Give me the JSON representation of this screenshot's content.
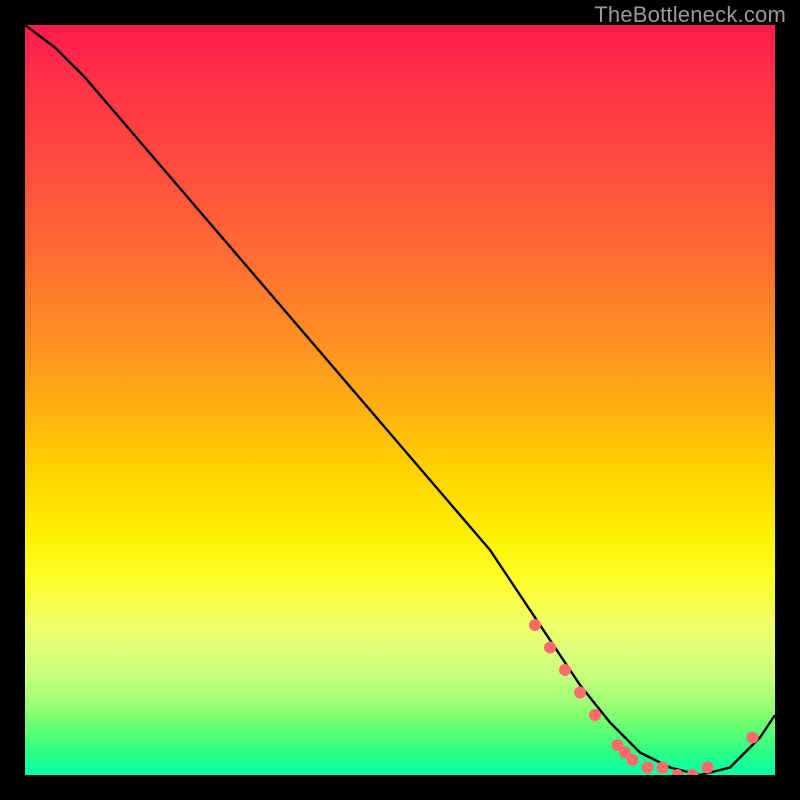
{
  "watermark": "TheBottleneck.com",
  "chart_data": {
    "type": "line",
    "title": "",
    "xlabel": "",
    "ylabel": "",
    "xlim": [
      0,
      100
    ],
    "ylim": [
      0,
      100
    ],
    "series": [
      {
        "name": "curve",
        "x": [
          0,
          4,
          8,
          14,
          20,
          26,
          32,
          38,
          44,
          50,
          56,
          62,
          66,
          70,
          74,
          78,
          82,
          86,
          90,
          94,
          98,
          100
        ],
        "y": [
          100,
          97,
          93,
          86,
          79,
          72,
          65,
          58,
          51,
          44,
          37,
          30,
          24,
          18,
          12,
          7,
          3,
          1,
          0,
          1,
          5,
          8
        ]
      }
    ],
    "markers": [
      {
        "x": 68,
        "y": 20
      },
      {
        "x": 70,
        "y": 17
      },
      {
        "x": 72,
        "y": 14
      },
      {
        "x": 74,
        "y": 11
      },
      {
        "x": 76,
        "y": 8
      },
      {
        "x": 79,
        "y": 4
      },
      {
        "x": 80,
        "y": 3
      },
      {
        "x": 81,
        "y": 2
      },
      {
        "x": 83,
        "y": 1
      },
      {
        "x": 85,
        "y": 1
      },
      {
        "x": 87,
        "y": 0
      },
      {
        "x": 89,
        "y": 0
      },
      {
        "x": 91,
        "y": 1
      },
      {
        "x": 97,
        "y": 5
      }
    ],
    "marker_style": {
      "shape": "circle",
      "color": "#ff6a6a",
      "radius_px": 6
    }
  }
}
